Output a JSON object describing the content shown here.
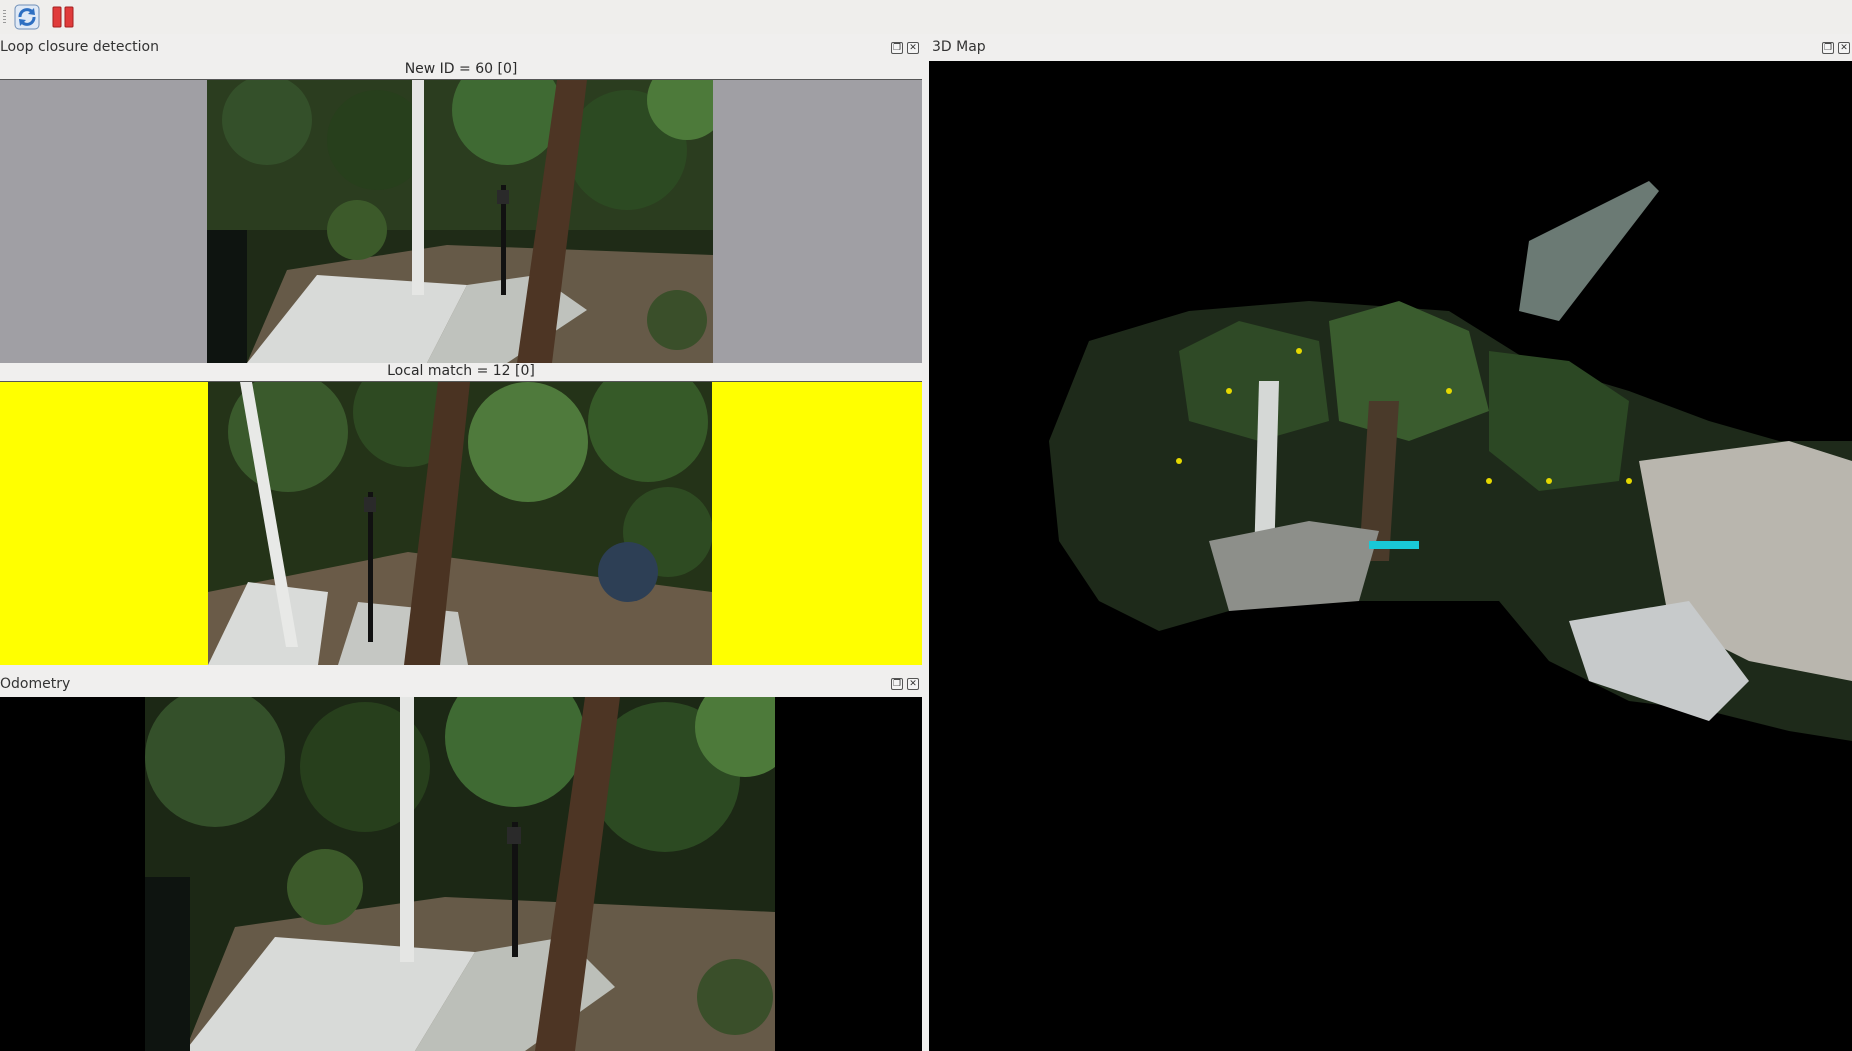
{
  "toolbar": {
    "refresh_icon": "refresh-icon",
    "pause_icon": "pause-icon"
  },
  "loop_closure": {
    "title": "Loop closure detection",
    "new_id_label": "New ID = 60 [0]",
    "local_match_label": "Local match = 12 [0]",
    "new_bg_color": "#a09fa4",
    "match_bg_color": "#ffff00"
  },
  "odometry": {
    "title": "Odometry"
  },
  "map3d": {
    "title": "3D Map",
    "bg_color": "#000000"
  }
}
